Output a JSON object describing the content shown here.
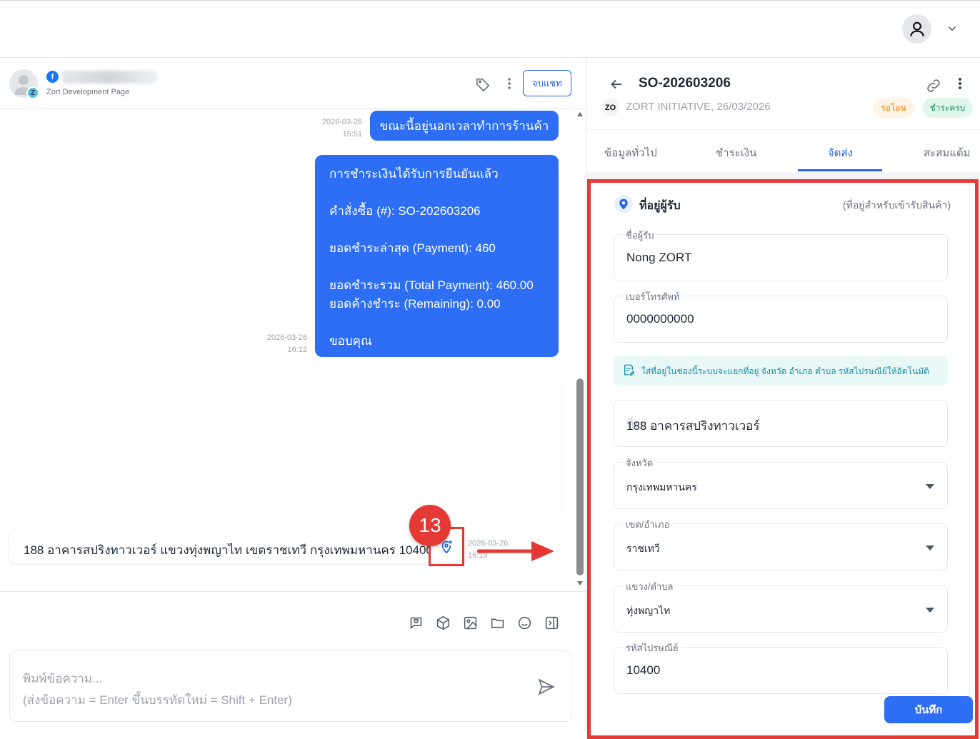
{
  "topbar": {
    "user_icon": "user-icon",
    "caret_icon": "chevron-down-icon"
  },
  "chat": {
    "header": {
      "badge": "Z",
      "platform_icon": "f",
      "page_name": "Zort Development Page",
      "end_button": "จบแชท"
    },
    "messages": [
      {
        "date": "2026-03-26",
        "time": "15:51",
        "text": "ขณะนี้อยู่นอกเวลาทำการร้านค้า"
      },
      {
        "date": "2026-03-26",
        "time": "16:12",
        "text": "การชำระเงินได้รับการยืนยันแล้ว\n\nคำสั่งซื้อ (#): SO-202603206\n\nยอดชำระล่าสุด (Payment): 460\n\nยอดชำระรวม (Total Payment): 460.00\nยอดค้างชำระ (Remaining): 0.00\n\nขอบคุณ"
      }
    ],
    "customer_message": {
      "text": "188 อาคารสปริงทาวเวอร์ แขวงทุ่งพญาไท เขตราชเทวี กรุงเทพมหานคร 10400",
      "date": "2026-03-26",
      "time": "16:19"
    },
    "step_badge": "13",
    "composer": {
      "placeholder_line1": "พิมพ์ข้อความ...",
      "placeholder_line2": "(ส่งข้อความ = Enter ขึ้นบรรทัดใหม่ = Shift + Enter)"
    },
    "tool_icons": [
      "sticker-icon",
      "product-box-icon",
      "image-icon",
      "folder-icon",
      "emoji-icon",
      "panel-toggle-icon"
    ]
  },
  "order": {
    "number": "SO-202603206",
    "shop_badge": "ZO",
    "shop_line": "ZORT INITIATIVE, 26/03/2026",
    "status_pills": [
      "รอโอน",
      "ชำระครบ"
    ],
    "tabs": [
      "ข้อมูลทั่วไป",
      "ชำระเงิน",
      "จัดส่ง",
      "สะสมแต้ม"
    ],
    "active_tab": "จัดส่ง",
    "section_title": "ที่อยู่ผู้รับ",
    "section_hint": "(ที่อยู่สำหรับเข้ารับสินค้า)",
    "fields": {
      "name_label": "ชื่อผู้รับ",
      "name_value": "Nong ZORT",
      "phone_label": "เบอร์โทรศัพท์",
      "phone_value": "0000000000",
      "info_text": "ใส่ที่อยู่ในช่องนี้ระบบจะแยกที่อยู่ จังหวัด อำเภอ ตำบล รหัสไปรษณีย์ให้อัตโนมัติ",
      "address_ghost": "ที่อยู่",
      "address_value": "188 อาคารสปริงทาวเวอร์",
      "province_label": "จังหวัด",
      "province_value": "กรุงเทพมหานคร",
      "district_label": "เขต/อำเภอ",
      "district_value": "ราชเทวี",
      "subdistrict_label": "แขวง/ตำบล",
      "subdistrict_value": "ทุ่งพญาไท",
      "postcode_label": "รหัสไปรษณีย์",
      "postcode_value": "10400"
    },
    "save_button": "บันทึก"
  }
}
